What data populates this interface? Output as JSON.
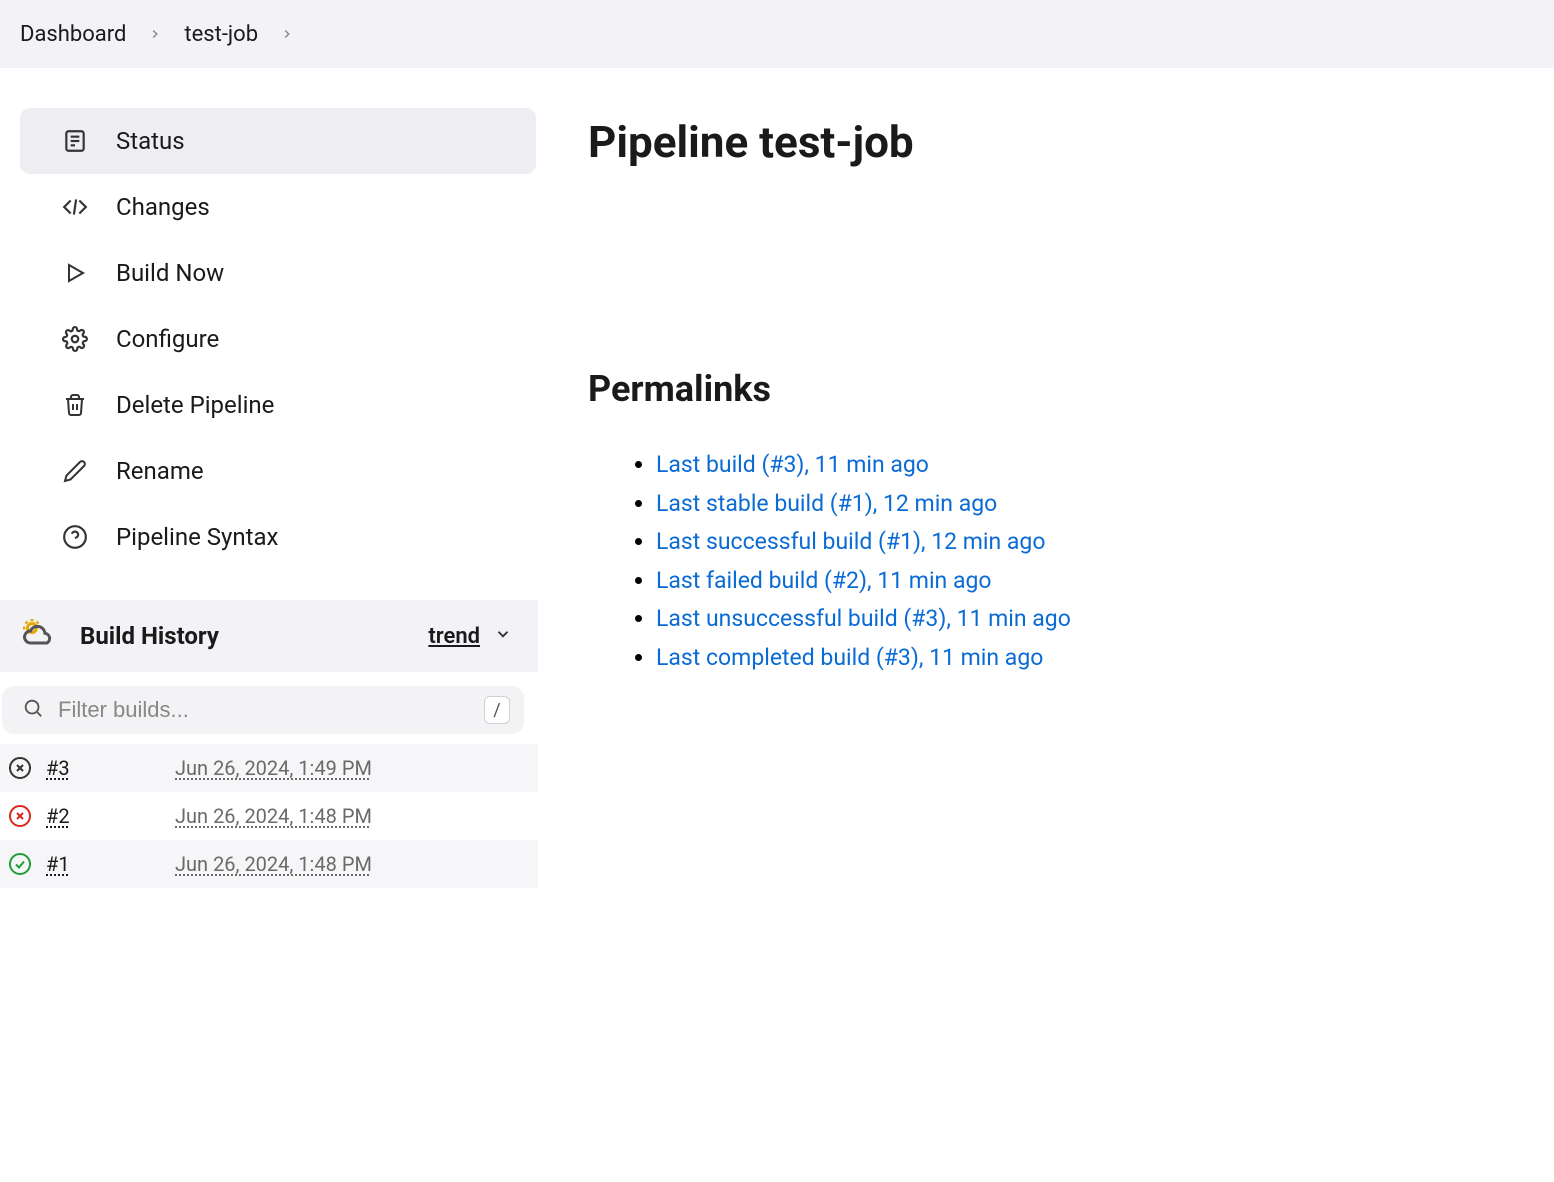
{
  "breadcrumb": [
    {
      "label": "Dashboard"
    },
    {
      "label": "test-job"
    }
  ],
  "sidebar": {
    "items": [
      {
        "label": "Status",
        "active": true
      },
      {
        "label": "Changes"
      },
      {
        "label": "Build Now"
      },
      {
        "label": "Configure"
      },
      {
        "label": "Delete Pipeline"
      },
      {
        "label": "Rename"
      },
      {
        "label": "Pipeline Syntax"
      }
    ]
  },
  "build_history": {
    "title": "Build History",
    "trend_label": "trend",
    "search_placeholder": "Filter builds...",
    "slash_hint": "/",
    "builds": [
      {
        "number": "#3",
        "date": "Jun 26, 2024, 1:49 PM",
        "status": "aborted"
      },
      {
        "number": "#2",
        "date": "Jun 26, 2024, 1:48 PM",
        "status": "failed"
      },
      {
        "number": "#1",
        "date": "Jun 26, 2024, 1:48 PM",
        "status": "success"
      }
    ]
  },
  "main": {
    "title": "Pipeline test-job",
    "permalinks_title": "Permalinks",
    "permalinks": [
      {
        "label": "Last build (#3), 11 min ago"
      },
      {
        "label": "Last stable build (#1), 12 min ago"
      },
      {
        "label": "Last successful build (#1), 12 min ago"
      },
      {
        "label": "Last failed build (#2), 11 min ago"
      },
      {
        "label": "Last unsuccessful build (#3), 11 min ago"
      },
      {
        "label": "Last completed build (#3), 11 min ago"
      }
    ]
  }
}
